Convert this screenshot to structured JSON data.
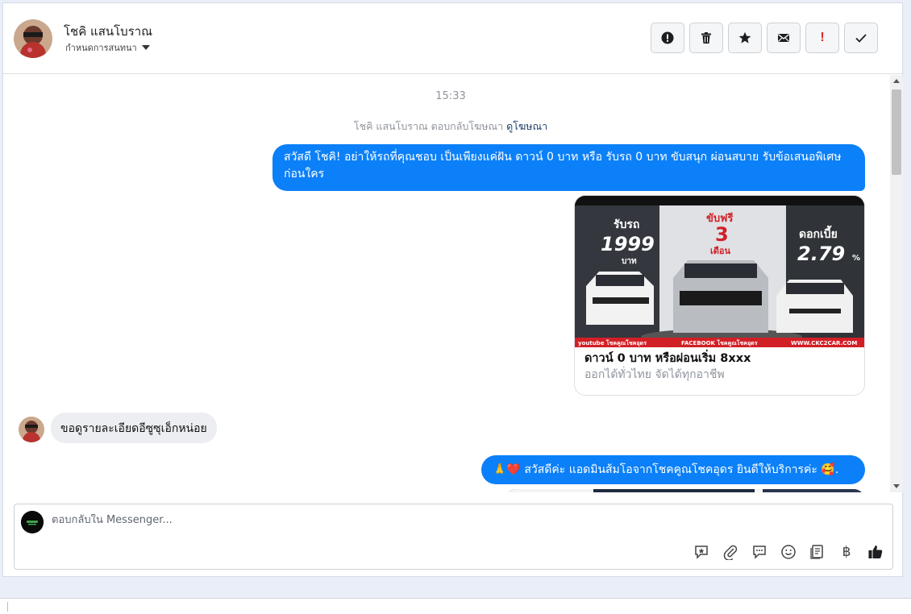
{
  "header": {
    "contact_name": "โชคิ แสนโบราณ",
    "assign_label": "กำหนดการสนทนา",
    "actions": [
      {
        "name": "report-button",
        "icon": "alert-circle-icon"
      },
      {
        "name": "delete-button",
        "icon": "trash-icon"
      },
      {
        "name": "star-button",
        "icon": "star-icon"
      },
      {
        "name": "mark-unread-button",
        "icon": "envelope-icon"
      },
      {
        "name": "spam-button",
        "icon": "exclamation-icon",
        "glyph": "!"
      },
      {
        "name": "mark-done-button",
        "icon": "check-icon"
      }
    ]
  },
  "thread": {
    "timestamp": "15:33",
    "ad_reply_text": "โชคิ แสนโบราณ ตอบกลับโฆษณา",
    "ad_link": "ดูโฆษณา",
    "messages": {
      "out_1": "สวัสดี โชคิ! อย่าให้รถที่คุณชอบ เป็นเพียงแค่ฝัน ดาวน์ 0 บาท หรือ รับรถ 0 บาท ขับสนุก ผ่อนสบาย รับข้อเสนอพิเศษก่อนใคร",
      "card_title": "ดาวน์ 0 บาท หรือผ่อนเริ่ม 8xxx",
      "card_subtitle": "ออกได้ทั่วไทย จัดได้ทุกอาชีพ",
      "in_1": "ขอดูรายละเอียดอีซูซุเอ็กหน่อย",
      "out_2": "🙏❤️ สวัสดีค่ะ แอดมินส้มโอจากโชคคูณโชคอุดร ยินดีให้บริการค่ะ 🥰."
    },
    "ad_image": {
      "left_top": "รับรถ",
      "left_big": "1999",
      "left_unit": "บาท",
      "mid_top": "ขับฟรี",
      "mid_big": "3",
      "mid_unit": "เดือน",
      "right_top": "ดอกเบี้ย",
      "right_big": "2.79",
      "right_unit": "%",
      "footer_left": "youtube โชคคูณโชคอุดร",
      "footer_mid": "FACEBOOK โชคคูณโชคอุดร",
      "footer_right": "WWW.CKC2CAR.COM"
    }
  },
  "composer": {
    "placeholder": "ตอบกลับใน Messenger...",
    "tools": [
      "saved-reply-icon",
      "attachment-icon",
      "chat-bubble-icon",
      "emoji-icon",
      "sticker-book-icon",
      "baht-icon",
      "thumbs-up-icon"
    ],
    "baht_glyph": "฿"
  },
  "colors": {
    "accent": "#0b80f9",
    "incoming_bubble": "#eceef1",
    "alert_red": "#e0282e"
  }
}
